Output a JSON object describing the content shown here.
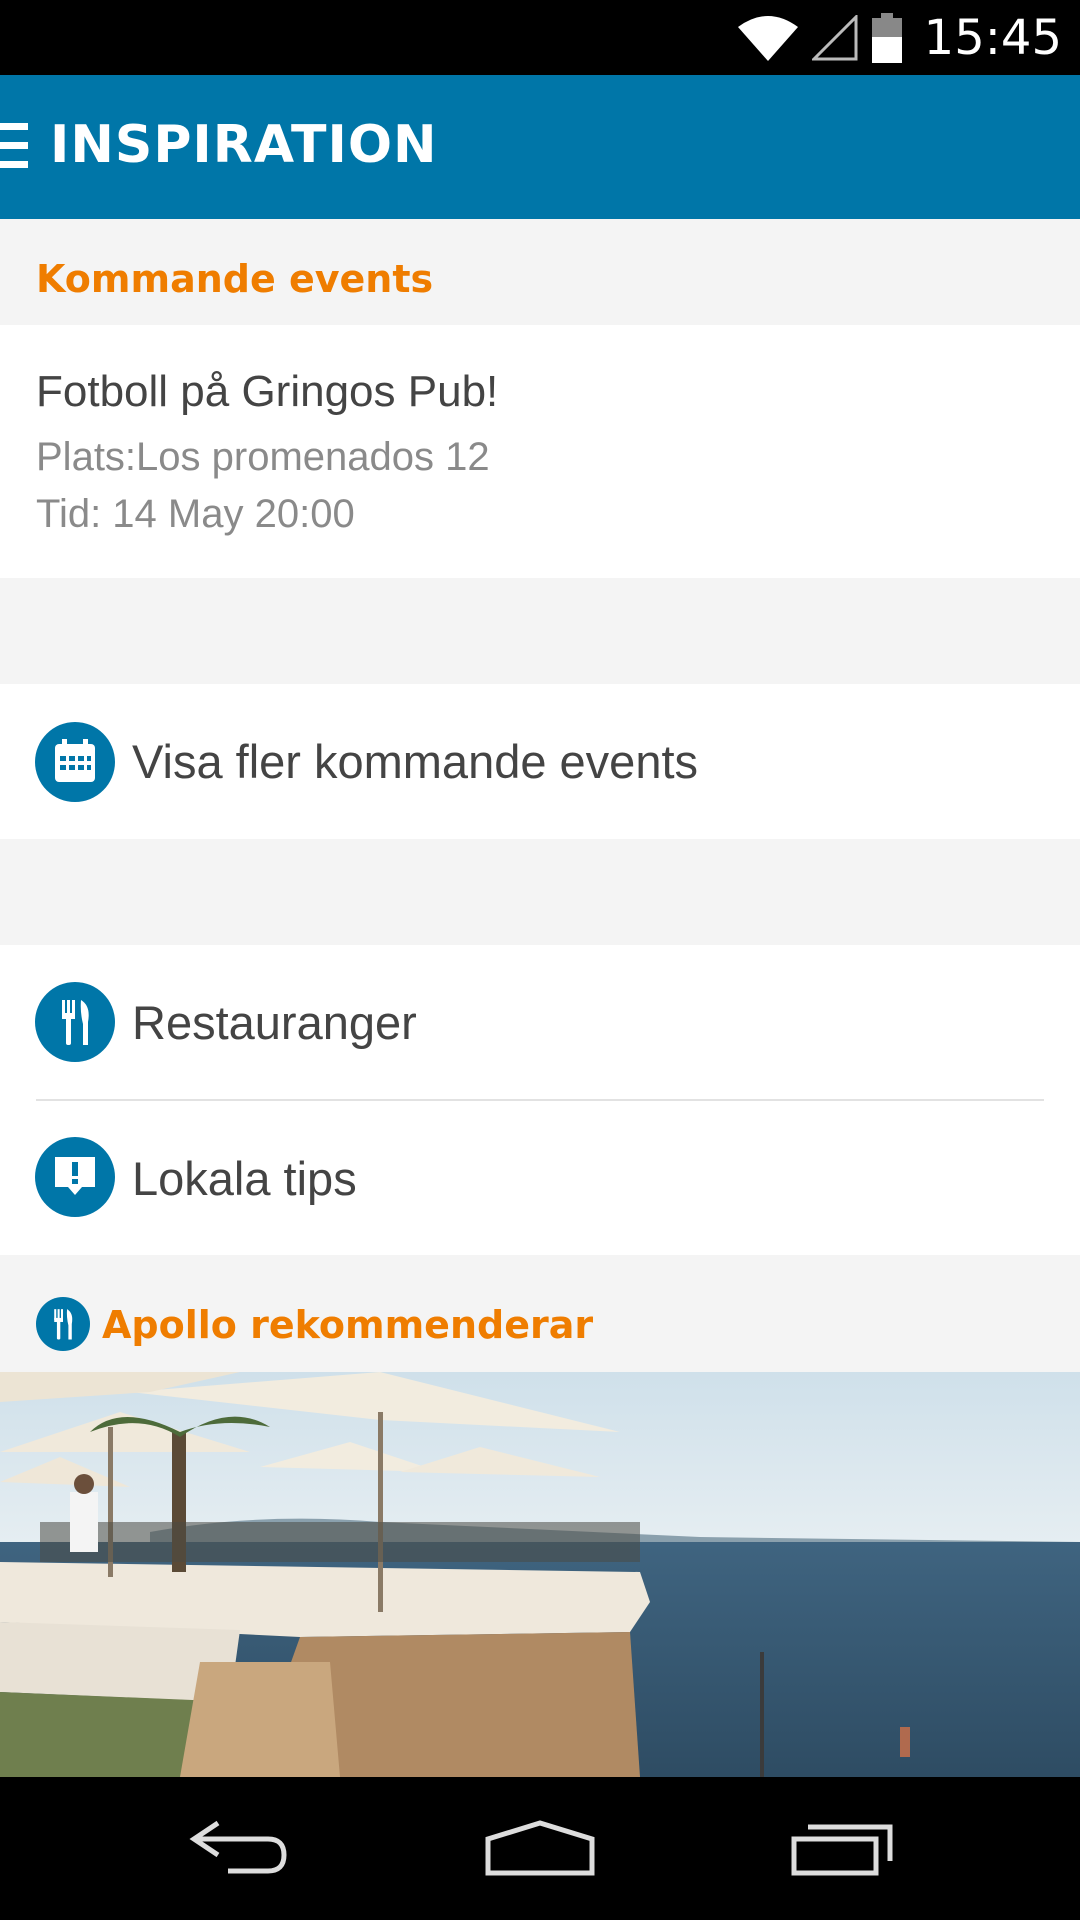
{
  "status_bar": {
    "time": "15:45"
  },
  "app_bar": {
    "title": "INSPIRATION"
  },
  "events": {
    "header": "Kommande events",
    "item": {
      "title": "Fotboll på Gringos Pub!",
      "place": "Plats:Los promenados 12",
      "time": "Tid: 14 May 20:00"
    },
    "more_label": "Visa fler kommande events"
  },
  "menu_rows": [
    {
      "label": "Restauranger",
      "icon": "cutlery-icon"
    },
    {
      "label": "Lokala tips",
      "icon": "tip-speech-icon"
    }
  ],
  "recommend": {
    "header": "Apollo rekommenderar",
    "icon": "cutlery-icon"
  },
  "colors": {
    "primary": "#0076a8",
    "accent": "#ef7d00",
    "background": "#f4f4f4"
  }
}
